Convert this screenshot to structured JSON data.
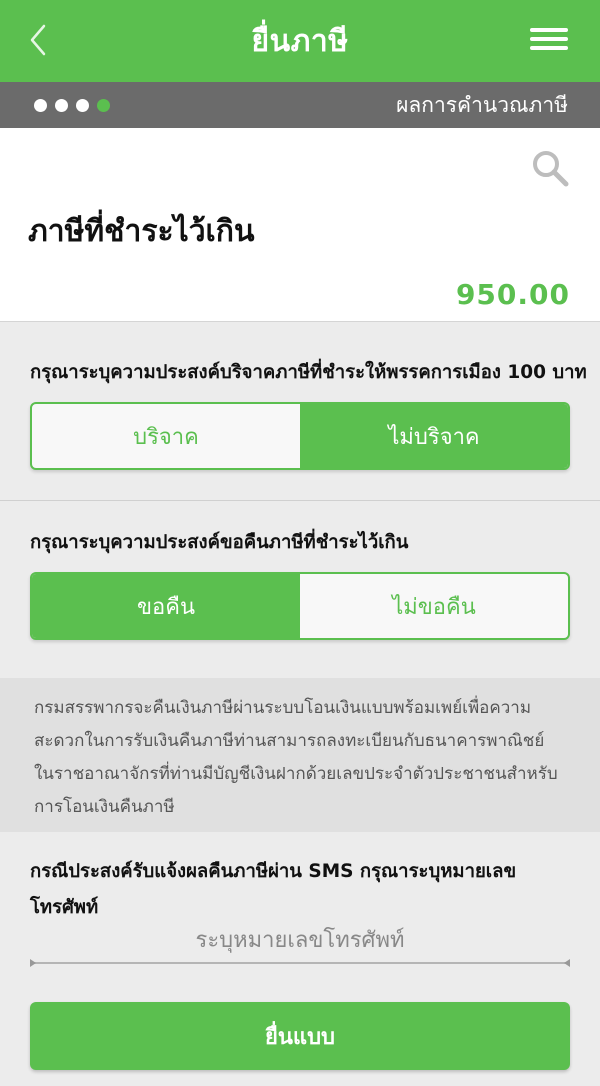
{
  "header": {
    "title": "ยื่นภาษี",
    "back_icon": "chevron-left-icon",
    "menu_icon": "hamburger-menu-icon"
  },
  "stepper": {
    "total_steps": 4,
    "current_step": 4,
    "label": "ผลการคำนวณภาษี"
  },
  "result": {
    "search_icon": "search-icon",
    "label": "ภาษีที่ชำระไว้เกิน",
    "amount": "950.00"
  },
  "donation": {
    "question": "กรุณาระบุความประสงค์บริจาคภาษีที่ชำระให้พรรคการเมือง 100 บาท",
    "options": [
      "บริจาค",
      "ไม่บริจาค"
    ],
    "selected_index": 1
  },
  "refund": {
    "question": "กรุณาระบุความประสงค์ขอคืนภาษีที่ชำระไว้เกิน",
    "options": [
      "ขอคืน",
      "ไม่ขอคืน"
    ],
    "selected_index": 0
  },
  "info": {
    "lines": [
      "กรมสรรพากรจะคืนเงินภาษีผ่านระบบโอนเงินแบบพร้อมเพย์เพื่อความ",
      "สะดวกในการรับเงินคืนภาษีท่านสามารถลงทะเบียนกับธนาคารพาณิชย์",
      "ในราชอาณาจักรที่ท่านมีบัญชีเงินฝากด้วยเลขประจำตัวประชาชนสำหรับ",
      "การโอนเงินคืนภาษี"
    ]
  },
  "sms": {
    "question": "กรณีประสงค์รับแจ้งผลคืนภาษีผ่าน SMS กรุณาระบุหมายเลขโทรศัพท์",
    "phone_value": "",
    "phone_placeholder": "ระบุหมายเลขโทรศัพท์"
  },
  "submit_label": "ยื่นแบบ",
  "colors": {
    "brand_green": "#5bbf4f",
    "step_bar": "#6b6b6b",
    "background": "#ececec",
    "info_background": "#e0e0e0"
  }
}
